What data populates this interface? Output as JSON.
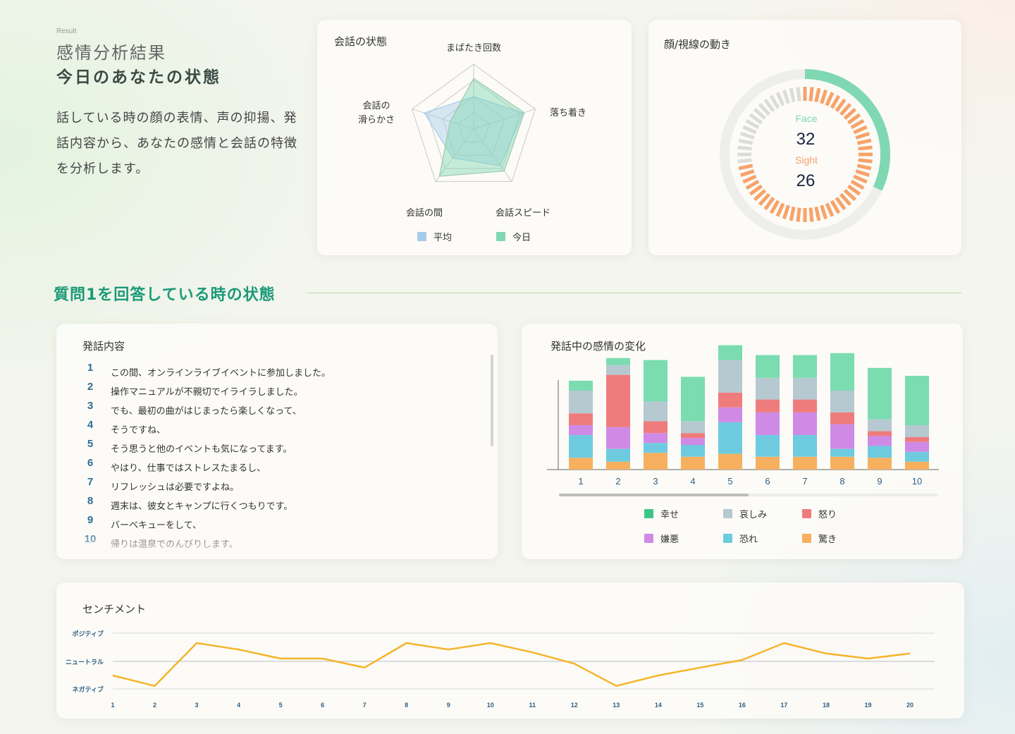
{
  "header": {
    "result_label": "Result",
    "title": "感情分析結果",
    "subtitle": "今日のあなたの状態",
    "description": "話している時の顔の表情、声の抑揚、発話内容から、あなたの感情と会話の特徴を分析します。"
  },
  "radar": {
    "title": "会話の状態",
    "axes": [
      "まばたき回数",
      "落ち着き",
      "会話スピード",
      "会話の間",
      "会話の\n滑らかさ"
    ],
    "legend": [
      {
        "label": "平均",
        "color": "#a7cce8"
      },
      {
        "label": "今日",
        "color": "#7fd8b2"
      }
    ],
    "average": [
      0.5,
      0.8,
      0.7,
      0.55,
      0.8
    ],
    "today": [
      0.78,
      0.82,
      0.8,
      0.9,
      0.38
    ]
  },
  "face_sight": {
    "title": "顔/視線の動き",
    "face_label": "Face",
    "face_value": "32",
    "sight_label": "Sight",
    "sight_value": "26",
    "face_fraction": 0.32,
    "sight_fraction": 0.74,
    "face_color": "#7fd8b2",
    "sight_color": "#f6a36a"
  },
  "section": {
    "title": "質問1を回答している時の状態"
  },
  "speech": {
    "title": "発話内容",
    "lines": [
      {
        "num": "1",
        "text": "この間、オンラインライブイベントに参加しました。"
      },
      {
        "num": "2",
        "text": "操作マニュアルが不親切でイライラしました。"
      },
      {
        "num": "3",
        "text": "でも、最初の曲がはじまったら楽しくなって、"
      },
      {
        "num": "4",
        "text": "そうですね、"
      },
      {
        "num": "5",
        "text": "そう思うと他のイベントも気になってます。"
      },
      {
        "num": "6",
        "text": "やはり、仕事ではストレスたまるし、"
      },
      {
        "num": "7",
        "text": "リフレッシュは必要ですよね。"
      },
      {
        "num": "8",
        "text": "週末は、彼女とキャンプに行くつもりです。"
      },
      {
        "num": "9",
        "text": "バーベキューをして、"
      },
      {
        "num": "10",
        "text": "帰りは温泉でのんびりします。"
      }
    ]
  },
  "chart_data": [
    {
      "type": "bar",
      "title": "発話中の感情の変化",
      "stacked": true,
      "categories": [
        "1",
        "2",
        "3",
        "4",
        "5",
        "6",
        "7",
        "8",
        "9",
        "10"
      ],
      "series": [
        {
          "name": "驚き",
          "color": "#f6b060",
          "values": [
            12,
            8,
            17,
            13,
            16,
            13,
            13,
            13,
            12,
            8
          ]
        },
        {
          "name": "恐れ",
          "color": "#6ecbdf",
          "values": [
            23,
            13,
            10,
            12,
            32,
            22,
            22,
            8,
            12,
            10
          ]
        },
        {
          "name": "嫌悪",
          "color": "#cf8ae6",
          "values": [
            10,
            22,
            10,
            7,
            15,
            23,
            23,
            25,
            10,
            10
          ]
        },
        {
          "name": "怒り",
          "color": "#ef7c7c",
          "values": [
            12,
            53,
            12,
            5,
            15,
            13,
            13,
            12,
            5,
            5
          ]
        },
        {
          "name": "哀しみ",
          "color": "#b6c8d0",
          "values": [
            23,
            10,
            20,
            12,
            33,
            22,
            22,
            22,
            12,
            12
          ]
        },
        {
          "name": "幸せ",
          "color": "#7adcb0",
          "values": [
            10,
            7,
            42,
            45,
            15,
            23,
            23,
            38,
            52,
            50
          ]
        }
      ],
      "legend_order": [
        "幸せ",
        "哀しみ",
        "怒り",
        "嫌悪",
        "恐れ",
        "驚き"
      ],
      "legend_colors": {
        "幸せ": "#3ec688",
        "哀しみ": "#b6c8d0",
        "怒り": "#ef7c7c",
        "嫌悪": "#cf8ae6",
        "恐れ": "#6ecbdf",
        "驚き": "#f6b060"
      },
      "scroll_fraction": 0.5
    },
    {
      "type": "line",
      "title": "センチメント",
      "x": [
        "1",
        "2",
        "3",
        "4",
        "5",
        "6",
        "7",
        "8",
        "9",
        "10",
        "11",
        "12",
        "13",
        "14",
        "15",
        "16",
        "17",
        "18",
        "19",
        "20"
      ],
      "y_labels": [
        "ポジティブ",
        "ニュートラル",
        "ネガティブ"
      ],
      "ylim": [
        -1,
        1
      ],
      "values": [
        -0.5,
        -0.87,
        0.65,
        0.42,
        0.1,
        0.1,
        -0.22,
        0.65,
        0.42,
        0.65,
        0.32,
        -0.08,
        -0.87,
        -0.5,
        -0.22,
        0.05,
        0.65,
        0.28,
        0.1,
        0.28
      ],
      "color": "#f5b42a"
    }
  ]
}
